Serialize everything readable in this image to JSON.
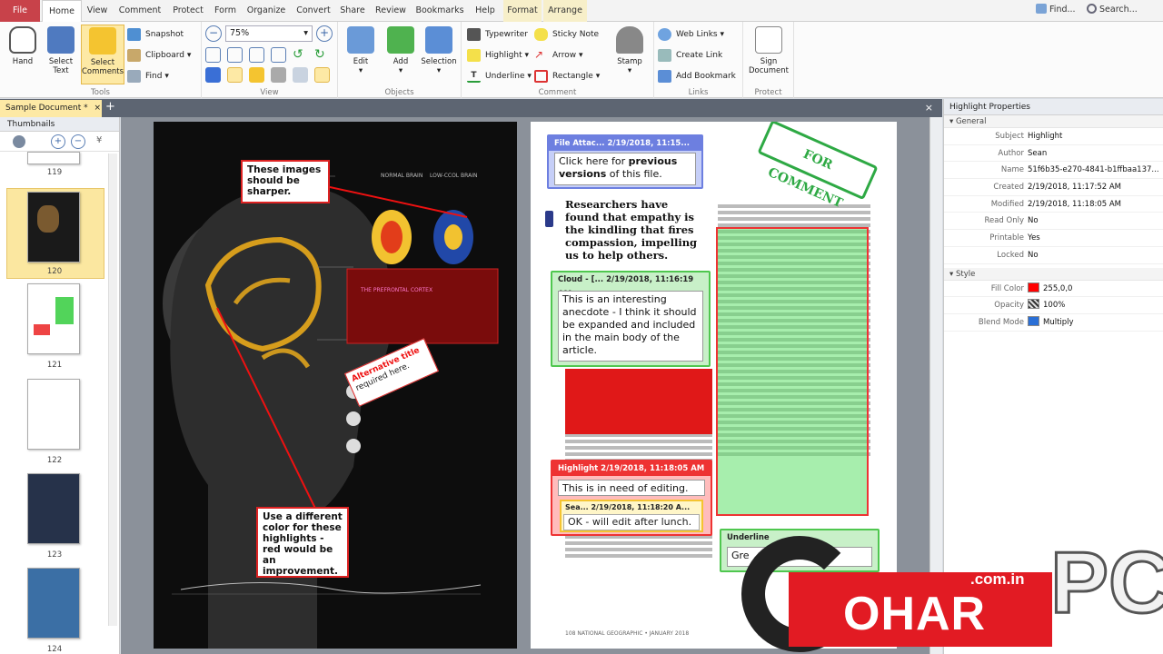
{
  "tabs": [
    "File",
    "Home",
    "View",
    "Comment",
    "Protect",
    "Form",
    "Organize",
    "Convert",
    "Share",
    "Review",
    "Bookmarks",
    "Help",
    "Format",
    "Arrange"
  ],
  "topright": {
    "find": "Find...",
    "search": "Search..."
  },
  "ribbon": {
    "tools": {
      "hand": "Hand",
      "select_text": "Select Text",
      "select_comments": "Select Comments",
      "snapshot": "Snapshot",
      "clipboard": "Clipboard",
      "find": "Find",
      "group": "Tools"
    },
    "view": {
      "zoom": "75%",
      "group": "View"
    },
    "objects": {
      "edit": "Edit",
      "add": "Add",
      "selection": "Selection",
      "group": "Objects"
    },
    "comment": {
      "typewriter": "Typewriter",
      "sticky_note": "Sticky Note",
      "highlight": "Highlight",
      "arrow": "Arrow",
      "underline": "Underline",
      "rectangle": "Rectangle",
      "stamp": "Stamp",
      "group": "Comment"
    },
    "links": {
      "web_links": "Web Links",
      "create_link": "Create Link",
      "add_bookmark": "Add Bookmark",
      "group": "Links"
    },
    "protect": {
      "sign_document": "Sign Document",
      "group": "Protect"
    }
  },
  "document": {
    "tab": "Sample Document *",
    "plus": "+",
    "close": "×"
  },
  "thumbnails": {
    "title": "Thumbnails",
    "pages": [
      "119",
      "120",
      "121",
      "122",
      "123",
      "124"
    ]
  },
  "left_page": {
    "note_top": "These images should be sharper.",
    "note_bottom": "Use a different color for these highlights - red would be an improvement.",
    "alt_title_1": "Alternative title",
    "alt_title_2": "required here.",
    "label_normal": "NORMAL BRAIN",
    "label_low": "LOW-CCOL BRAIN",
    "box_title": "THE PREFRONTAL CORTEX"
  },
  "right_page": {
    "file_attach_hdr": "File Attac... 2/19/2018, 11:15...",
    "file_attach_body_1": "Click here for ",
    "file_attach_bold_1": "previous versions",
    "file_attach_body_2": " of this file.",
    "headline": "Researchers have found that empathy is the kindling that fires compassion, impelling us to help others.",
    "cloud_hdr": "Cloud - [... 2/19/2018, 11:16:19 AM",
    "cloud_body": "This is an interesting anecdote - I think it should be expanded and included in the main body of the article.",
    "highlight_hdr": "Highlight  2/19/2018, 11:18:05 AM",
    "highlight_body": "This is in need of editing.",
    "reply_hdr": "Sea... 2/19/2018, 11:18:20 A...",
    "reply_body": "OK - will edit after lunch.",
    "underline_hdr": "Underline",
    "underline_body": "Gre",
    "stamp": "FOR COMMENT",
    "footer": "108  NATIONAL GEOGRAPHIC • JANUARY 2018"
  },
  "properties": {
    "title": "Highlight Properties",
    "general": "General",
    "style": "Style",
    "rows": [
      {
        "k": "Subject",
        "v": "Highlight"
      },
      {
        "k": "Author",
        "v": "Sean"
      },
      {
        "k": "Name",
        "v": "51f6b35-e270-4841-b1ffbaa137..."
      },
      {
        "k": "Created",
        "v": "2/19/2018, 11:17:52 AM"
      },
      {
        "k": "Modified",
        "v": "2/19/2018, 11:18:05 AM"
      },
      {
        "k": "Read Only",
        "v": "No"
      },
      {
        "k": "Printable",
        "v": "Yes"
      },
      {
        "k": "Locked",
        "v": "No"
      }
    ],
    "style_rows": [
      {
        "k": "Fill Color",
        "v": "255,0,0"
      },
      {
        "k": "Opacity",
        "v": "100%"
      },
      {
        "k": "Blend Mode",
        "v": "Multiply"
      }
    ]
  },
  "watermark": {
    "domain": ".com.in",
    "brand": "OHAR",
    "pc": "PC"
  },
  "colors": {
    "file_tab": "#c8424a",
    "select_hl": "#fde9a5",
    "red": "#ee1d1d",
    "green": "#42c94a",
    "blue": "#5b6fd6"
  }
}
